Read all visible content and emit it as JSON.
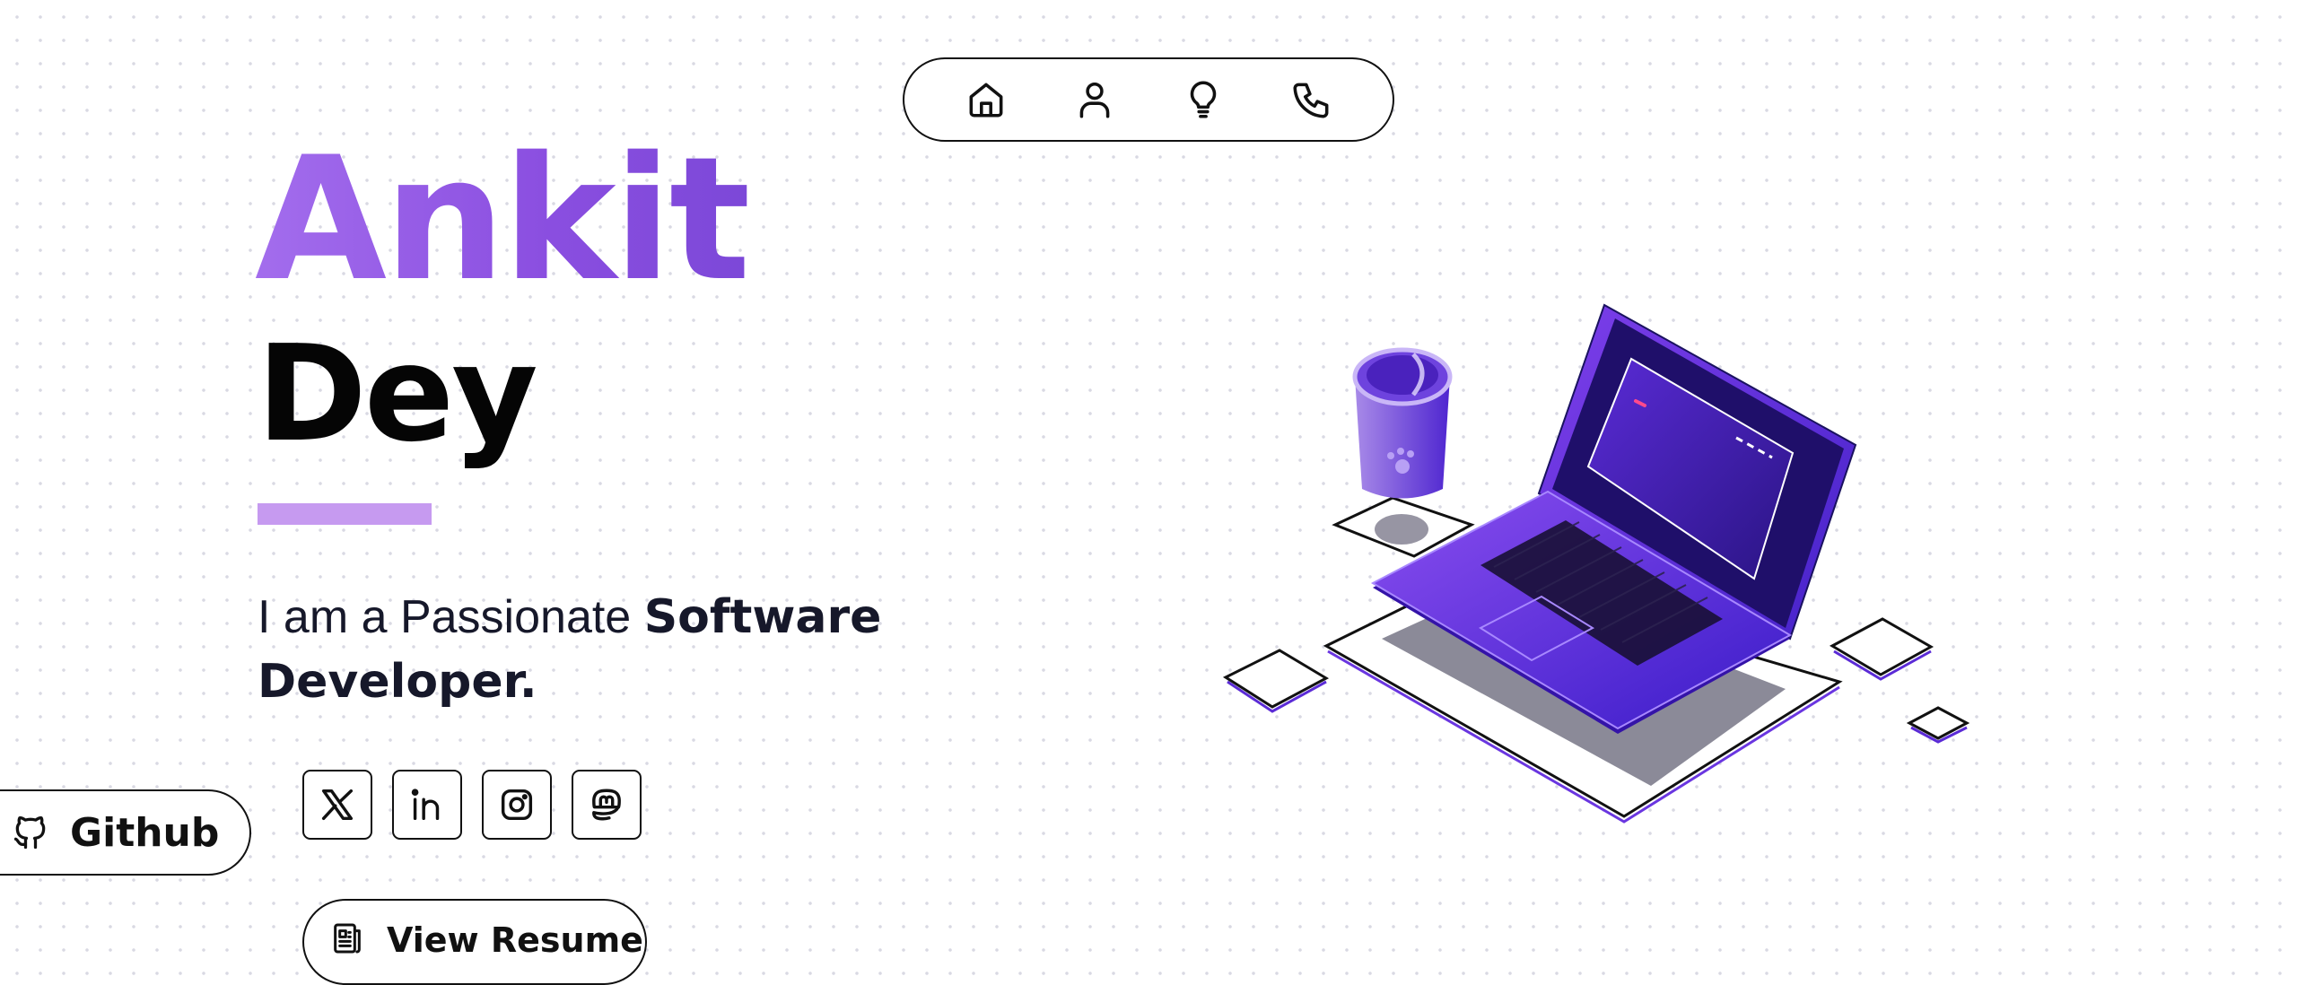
{
  "nav": {
    "items": [
      {
        "icon": "home-icon"
      },
      {
        "icon": "user-icon"
      },
      {
        "icon": "lightbulb-icon"
      },
      {
        "icon": "phone-icon"
      }
    ]
  },
  "hero": {
    "first_name": "Ankit",
    "last_name": "Dey",
    "tagline_intro": "I am a Passionate ",
    "tagline_role": "Software Developer."
  },
  "github": {
    "label": "Github",
    "icon": "github-icon"
  },
  "socials": [
    {
      "icon": "x-icon"
    },
    {
      "icon": "linkedin-icon"
    },
    {
      "icon": "instagram-icon"
    },
    {
      "icon": "mastodon-icon"
    }
  ],
  "resume": {
    "label": "View Resume",
    "icon": "document-icon"
  },
  "colors": {
    "accent": "#8b4fe2",
    "accent_light": "#c69af0",
    "text_dark": "#16182a",
    "laptop_purple": "#7b3fe4"
  }
}
